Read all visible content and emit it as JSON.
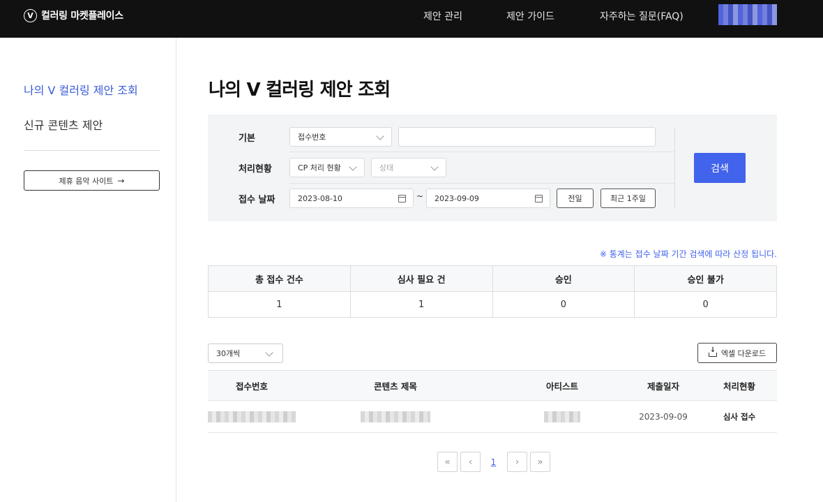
{
  "header": {
    "logo_mark": "V",
    "brand": "컬러링 마켓플레이스",
    "nav": [
      "제안 관리",
      "제안 가이드",
      "자주하는 질문(FAQ)"
    ]
  },
  "sidebar": {
    "items": [
      {
        "label": "나의 V 컬러링 제안 조회",
        "active": true
      },
      {
        "label": "신규 콘텐츠 제안",
        "active": false
      }
    ],
    "partner_button": "제휴 음악 사이트",
    "partner_arrow": "→"
  },
  "page_title": "나의 V 컬러링 제안 조회",
  "filters": {
    "basic_label": "기본",
    "basic_select": "접수번호",
    "basic_input_value": "",
    "status_label": "처리현황",
    "cp_select": "CP 처리 현황",
    "status_select_placeholder": "상태",
    "date_label": "접수 날짜",
    "date_from": "2023-08-10",
    "date_separator": "~",
    "date_to": "2023-09-09",
    "prev_day": "전일",
    "last_week": "최근 1주일",
    "search": "검색"
  },
  "notice": "※ 통계는 접수 날짜 기간 검색에 따라 산정 됩니다.",
  "stats": {
    "headers": [
      "총 접수 건수",
      "심사 필요 건",
      "승인",
      "승인 불가"
    ],
    "values": [
      "1",
      "1",
      "0",
      "0"
    ]
  },
  "list_controls": {
    "page_size": "30개씩",
    "excel": "엑셀 다운로드"
  },
  "table": {
    "headers": [
      "접수번호",
      "콘텐츠 제목",
      "아티스트",
      "제출일자",
      "처리현황"
    ],
    "rows": [
      {
        "date": "2023-09-09",
        "status": "심사 접수"
      }
    ]
  },
  "pagination": {
    "first": "«",
    "prev": "‹",
    "current": "1",
    "next": "›",
    "last": "»"
  },
  "colors": {
    "topbar": "#111111",
    "accent": "#4263eb",
    "active_nav": "#3c5bd8"
  }
}
